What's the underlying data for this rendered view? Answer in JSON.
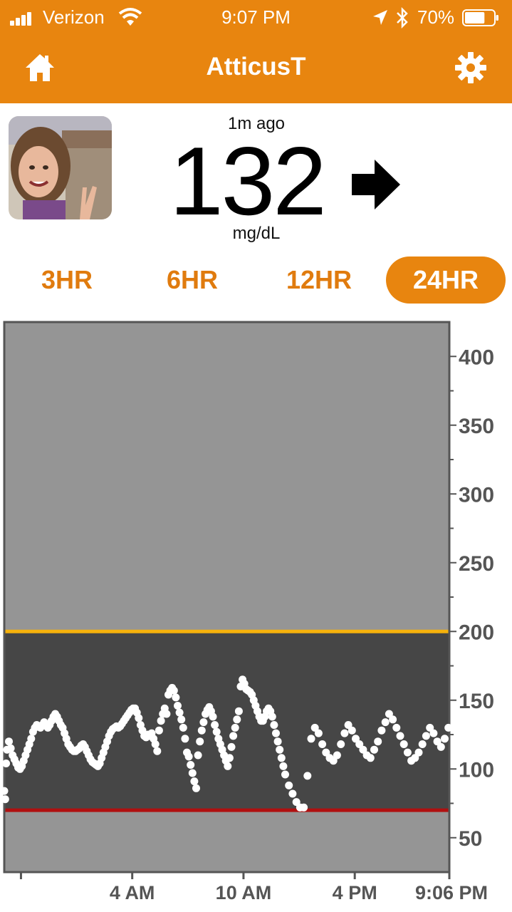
{
  "status_bar": {
    "carrier": "Verizon",
    "time": "9:07 PM",
    "battery_percent": "70%",
    "battery_level": 0.7
  },
  "nav": {
    "title": "AtticusT",
    "left_icon": "home-icon",
    "right_icon": "gear-icon"
  },
  "reading": {
    "ago": "1m ago",
    "value": "132",
    "units": "mg/dL",
    "trend_icon": "arrow-right-icon"
  },
  "range_tabs": [
    {
      "label": "3HR",
      "active": false
    },
    {
      "label": "6HR",
      "active": false
    },
    {
      "label": "12HR",
      "active": false
    },
    {
      "label": "24HR",
      "active": true
    }
  ],
  "colors": {
    "accent": "#e8850f",
    "high_line": "#f6b20c",
    "low_line": "#b01010",
    "out_of_range_bg": "#959595",
    "in_range_bg": "#464646"
  },
  "chart_data": {
    "type": "scatter",
    "ylim": [
      25,
      425
    ],
    "y_ticks": [
      50,
      100,
      150,
      200,
      250,
      300,
      350,
      400
    ],
    "x_range_hours": [
      21.1,
      45.1
    ],
    "x_tick_labels": [
      {
        "label": "4 AM",
        "hour": 28
      },
      {
        "label": "10 AM",
        "hour": 34
      },
      {
        "label": "4 PM",
        "hour": 40
      },
      {
        "label": "9:06 PM",
        "hour": 45.1
      }
    ],
    "x_minor_ticks": [
      22
    ],
    "high_threshold": 200,
    "low_threshold": 70,
    "readings": [
      [
        21.1,
        84
      ],
      [
        21.15,
        78
      ],
      [
        21.2,
        104
      ],
      [
        21.25,
        114
      ],
      [
        21.35,
        120
      ],
      [
        21.45,
        115
      ],
      [
        21.55,
        110
      ],
      [
        21.65,
        107
      ],
      [
        21.75,
        104
      ],
      [
        21.85,
        101
      ],
      [
        21.95,
        100
      ],
      [
        22.05,
        102
      ],
      [
        22.15,
        106
      ],
      [
        22.25,
        110
      ],
      [
        22.35,
        114
      ],
      [
        22.45,
        118
      ],
      [
        22.55,
        122
      ],
      [
        22.65,
        127
      ],
      [
        22.75,
        130
      ],
      [
        22.85,
        132
      ],
      [
        22.95,
        131
      ],
      [
        23.05,
        130
      ],
      [
        23.15,
        132
      ],
      [
        23.25,
        134
      ],
      [
        23.35,
        132
      ],
      [
        23.45,
        130
      ],
      [
        23.55,
        132
      ],
      [
        23.65,
        135
      ],
      [
        23.75,
        138
      ],
      [
        23.85,
        140
      ],
      [
        23.95,
        138
      ],
      [
        24.05,
        135
      ],
      [
        24.15,
        132
      ],
      [
        24.25,
        130
      ],
      [
        24.35,
        126
      ],
      [
        24.45,
        122
      ],
      [
        24.55,
        118
      ],
      [
        24.65,
        116
      ],
      [
        24.75,
        114
      ],
      [
        24.85,
        113
      ],
      [
        24.95,
        113
      ],
      [
        25.05,
        114
      ],
      [
        25.15,
        115
      ],
      [
        25.25,
        117
      ],
      [
        25.35,
        118
      ],
      [
        25.45,
        116
      ],
      [
        25.55,
        113
      ],
      [
        25.65,
        110
      ],
      [
        25.75,
        107
      ],
      [
        25.85,
        105
      ],
      [
        25.95,
        104
      ],
      [
        26.05,
        103
      ],
      [
        26.15,
        102
      ],
      [
        26.25,
        104
      ],
      [
        26.35,
        108
      ],
      [
        26.45,
        112
      ],
      [
        26.55,
        116
      ],
      [
        26.65,
        120
      ],
      [
        26.75,
        124
      ],
      [
        26.85,
        127
      ],
      [
        26.95,
        129
      ],
      [
        27.05,
        130
      ],
      [
        27.15,
        131
      ],
      [
        27.25,
        130
      ],
      [
        27.35,
        131
      ],
      [
        27.45,
        133
      ],
      [
        27.55,
        135
      ],
      [
        27.65,
        137
      ],
      [
        27.75,
        139
      ],
      [
        27.85,
        141
      ],
      [
        27.95,
        143
      ],
      [
        28.05,
        144
      ],
      [
        28.15,
        144
      ],
      [
        28.25,
        141
      ],
      [
        28.35,
        137
      ],
      [
        28.45,
        132
      ],
      [
        28.55,
        128
      ],
      [
        28.65,
        124
      ],
      [
        28.75,
        123
      ],
      [
        28.85,
        125
      ],
      [
        28.95,
        124
      ],
      [
        29.05,
        126
      ],
      [
        29.15,
        122
      ],
      [
        29.25,
        118
      ],
      [
        29.35,
        113
      ],
      [
        29.45,
        128
      ],
      [
        29.55,
        135
      ],
      [
        29.65,
        140
      ],
      [
        29.75,
        144
      ],
      [
        29.85,
        140
      ],
      [
        29.95,
        154
      ],
      [
        30.05,
        157
      ],
      [
        30.15,
        159
      ],
      [
        30.25,
        157
      ],
      [
        30.35,
        152
      ],
      [
        30.45,
        146
      ],
      [
        30.55,
        141
      ],
      [
        30.65,
        136
      ],
      [
        30.75,
        130
      ],
      [
        30.85,
        122
      ],
      [
        30.95,
        112
      ],
      [
        31.05,
        109
      ],
      [
        31.15,
        103
      ],
      [
        31.25,
        97
      ],
      [
        31.35,
        91
      ],
      [
        31.45,
        86
      ],
      [
        31.55,
        110
      ],
      [
        31.65,
        120
      ],
      [
        31.75,
        128
      ],
      [
        31.85,
        134
      ],
      [
        31.95,
        140
      ],
      [
        32.05,
        143
      ],
      [
        32.15,
        145
      ],
      [
        32.25,
        142
      ],
      [
        32.35,
        138
      ],
      [
        32.45,
        132
      ],
      [
        32.55,
        127
      ],
      [
        32.65,
        122
      ],
      [
        32.75,
        118
      ],
      [
        32.85,
        114
      ],
      [
        32.95,
        110
      ],
      [
        33.05,
        106
      ],
      [
        33.15,
        102
      ],
      [
        33.25,
        108
      ],
      [
        33.35,
        116
      ],
      [
        33.45,
        124
      ],
      [
        33.55,
        130
      ],
      [
        33.65,
        136
      ],
      [
        33.75,
        142
      ],
      [
        33.85,
        160
      ],
      [
        33.95,
        165
      ],
      [
        34.05,
        162
      ],
      [
        34.15,
        158
      ],
      [
        34.25,
        157
      ],
      [
        34.35,
        156
      ],
      [
        34.45,
        154
      ],
      [
        34.55,
        150
      ],
      [
        34.65,
        146
      ],
      [
        34.75,
        142
      ],
      [
        34.85,
        138
      ],
      [
        34.95,
        135
      ],
      [
        35.05,
        135
      ],
      [
        35.15,
        138
      ],
      [
        35.25,
        142
      ],
      [
        35.35,
        144
      ],
      [
        35.45,
        142
      ],
      [
        35.55,
        138
      ],
      [
        35.65,
        132
      ],
      [
        35.75,
        126
      ],
      [
        35.85,
        120
      ],
      [
        35.95,
        114
      ],
      [
        36.05,
        108
      ],
      [
        36.15,
        102
      ],
      [
        36.25,
        96
      ],
      [
        36.45,
        88
      ],
      [
        36.65,
        82
      ],
      [
        36.85,
        76
      ],
      [
        37.05,
        72
      ],
      [
        37.25,
        72
      ],
      [
        37.45,
        95
      ],
      [
        37.65,
        122
      ],
      [
        37.85,
        130
      ],
      [
        38.05,
        126
      ],
      [
        38.25,
        118
      ],
      [
        38.45,
        112
      ],
      [
        38.65,
        108
      ],
      [
        38.85,
        106
      ],
      [
        39.05,
        110
      ],
      [
        39.25,
        118
      ],
      [
        39.45,
        126
      ],
      [
        39.65,
        132
      ],
      [
        39.85,
        128
      ],
      [
        40.05,
        122
      ],
      [
        40.25,
        118
      ],
      [
        40.45,
        114
      ],
      [
        40.65,
        110
      ],
      [
        40.85,
        108
      ],
      [
        41.05,
        114
      ],
      [
        41.25,
        120
      ],
      [
        41.45,
        128
      ],
      [
        41.65,
        134
      ],
      [
        41.85,
        140
      ],
      [
        42.05,
        136
      ],
      [
        42.25,
        130
      ],
      [
        42.45,
        124
      ],
      [
        42.65,
        118
      ],
      [
        42.85,
        112
      ],
      [
        43.05,
        106
      ],
      [
        43.25,
        108
      ],
      [
        43.45,
        112
      ],
      [
        43.65,
        118
      ],
      [
        43.85,
        124
      ],
      [
        44.05,
        130
      ],
      [
        44.25,
        126
      ],
      [
        44.45,
        120
      ],
      [
        44.65,
        116
      ],
      [
        44.85,
        122
      ],
      [
        45.05,
        130
      ]
    ]
  }
}
